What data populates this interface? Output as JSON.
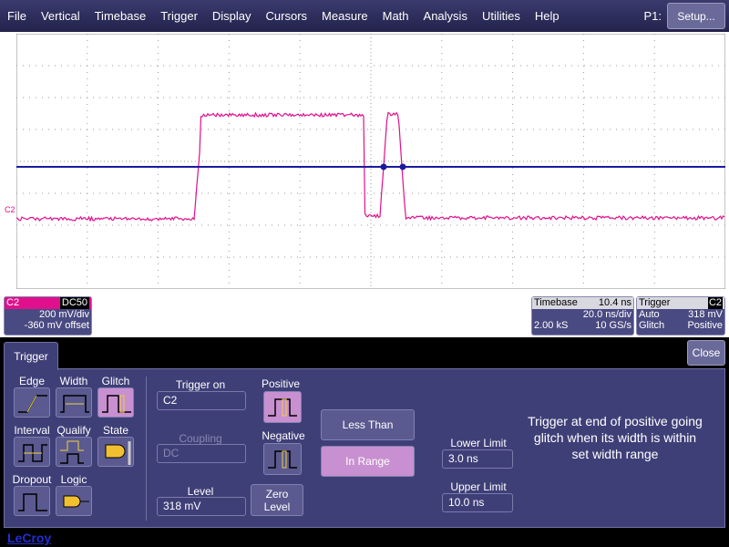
{
  "menu": [
    "File",
    "Vertical",
    "Timebase",
    "Trigger",
    "Display",
    "Cursors",
    "Measure",
    "Math",
    "Analysis",
    "Utilities",
    "Help"
  ],
  "p1_label": "P1:",
  "setup_label": "Setup...",
  "channel": {
    "name": "C2",
    "coupling": "DC50",
    "vdiv": "200 mV/div",
    "offset": "-360 mV offset",
    "color": "#e0108c"
  },
  "channel_marker": "C2",
  "timebase": {
    "title": "Timebase",
    "delay": "10.4 ns",
    "tdiv": "20.0 ns/div",
    "samples": "2.00 kS",
    "rate": "10 GS/s"
  },
  "trigger_box": {
    "title": "Trigger",
    "source": "C2",
    "mode": "Auto",
    "level": "318 mV",
    "type": "Glitch",
    "slope": "Positive"
  },
  "tab_label": "Trigger",
  "close_label": "Close",
  "types": [
    {
      "label": "Edge"
    },
    {
      "label": "Width"
    },
    {
      "label": "Glitch",
      "selected": true
    },
    {
      "label": "Interval"
    },
    {
      "label": "Qualify"
    },
    {
      "label": "State"
    },
    {
      "label": "Dropout"
    },
    {
      "label": "Logic"
    }
  ],
  "trigger_on": {
    "label": "Trigger on",
    "value": "C2"
  },
  "coupling": {
    "label": "Coupling",
    "value": "DC"
  },
  "level": {
    "label": "Level",
    "value": "318 mV"
  },
  "zero_level": "Zero Level",
  "positive": "Positive",
  "negative": "Negative",
  "less_than": "Less Than",
  "in_range": "In Range",
  "lower_limit": {
    "label": "Lower Limit",
    "value": "3.0 ns"
  },
  "upper_limit": {
    "label": "Upper Limit",
    "value": "10.0 ns"
  },
  "description": "Trigger at end of positive going glitch when its width is within set width range",
  "brand": "LeCroy"
}
